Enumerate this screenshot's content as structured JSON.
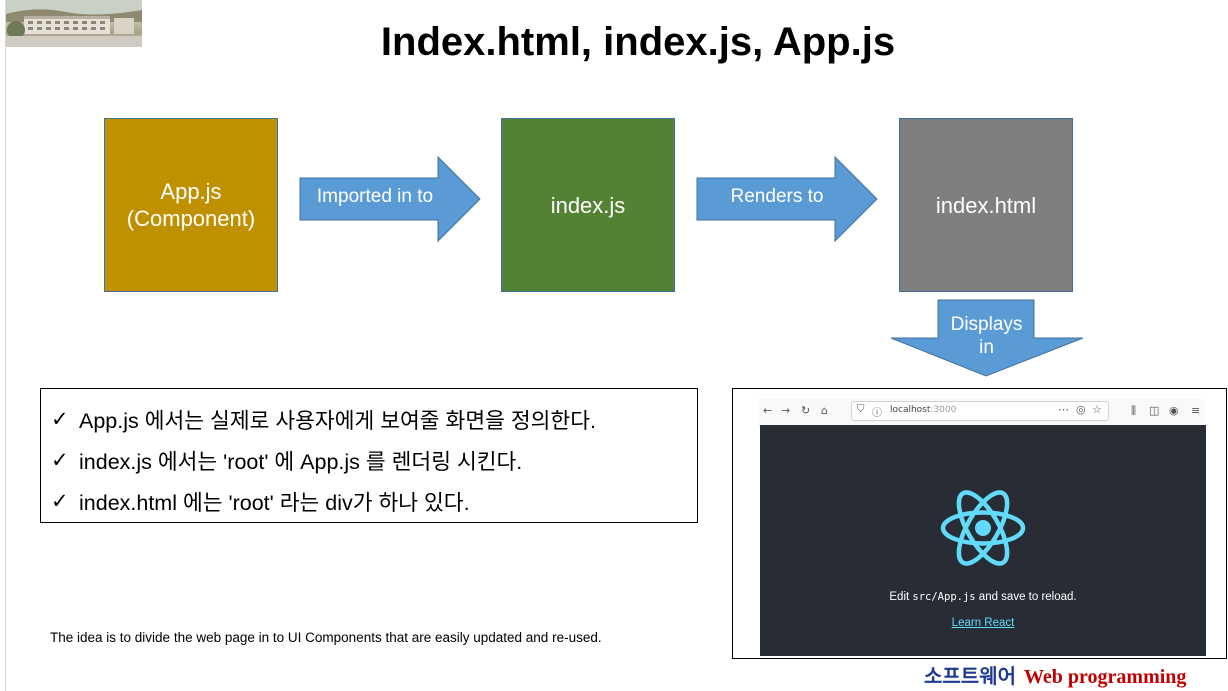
{
  "title": "Index.html, index.js, App.js",
  "boxes": {
    "app": "App.js\n(Component)",
    "index": "index.js",
    "html": "index.html"
  },
  "arrows": {
    "imported": "Imported in to",
    "renders": "Renders to",
    "displays": "Displays\nin"
  },
  "bullets": [
    "App.js 에서는 실제로 사용자에게 보여줄 화면을 정의한다.",
    "index.js 에서는 'root' 에 App.js 를 렌더링 시킨다.",
    "index.html 에는 'root' 라는 div가 하나 있다."
  ],
  "note": "The idea is to divide the web page in to UI Components that are easily updated and re-used.",
  "browser": {
    "url_host": "localhost",
    "url_port": ":3000",
    "edit_pre": "Edit ",
    "edit_code": "src/App.js",
    "edit_post": " and save to reload.",
    "link": "Learn React"
  },
  "footer": {
    "korean": "소프트웨어",
    "english": "Web programming"
  },
  "colors": {
    "app_box": "#bf9000",
    "index_box": "#548235",
    "html_box": "#7f7f7f",
    "arrow": "#5b9bd5",
    "react": "#61dafb",
    "viewport": "#282c34"
  }
}
